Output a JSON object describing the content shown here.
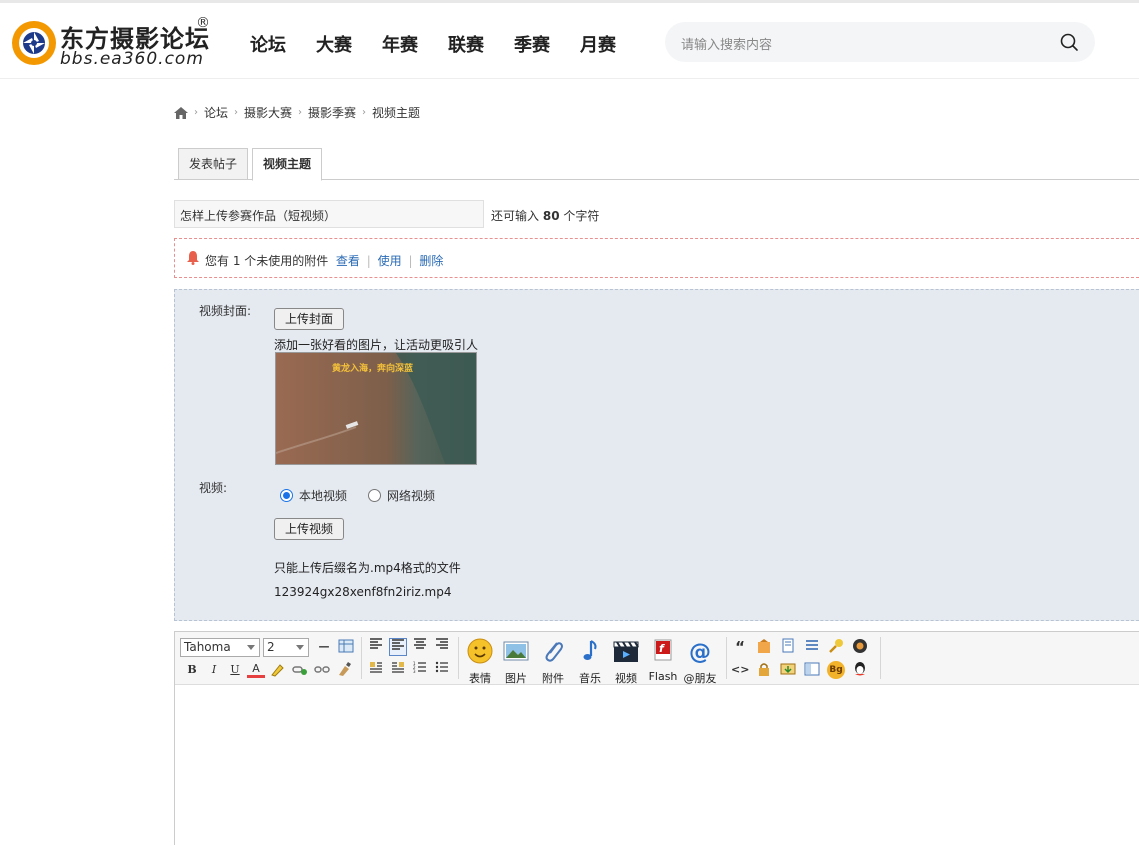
{
  "header": {
    "logo_title": "东方摄影论坛",
    "logo_reg": "®",
    "logo_url": "bbs.ea360.com",
    "nav": [
      "论坛",
      "大赛",
      "年赛",
      "联赛",
      "季赛",
      "月赛"
    ],
    "search_placeholder": "请输入搜索内容"
  },
  "breadcrumb": [
    "论坛",
    "摄影大赛",
    "摄影季赛",
    "视频主题"
  ],
  "tabs": [
    "发表帖子",
    "视频主题"
  ],
  "subject": {
    "value": "怎样上传参赛作品（短视频）",
    "remain_prefix": "还可输入",
    "remain_count": "80",
    "remain_suffix": "个字符"
  },
  "notice": {
    "text": "您有 1 个未使用的附件",
    "links": [
      "查看",
      "使用",
      "删除"
    ]
  },
  "cover": {
    "label": "视频封面:",
    "button": "上传封面",
    "hint": "添加一张好看的图片，让活动更吸引人",
    "image_caption": "黄龙入海，奔向深蓝"
  },
  "video": {
    "label": "视频:",
    "options": [
      "本地视频",
      "网络视频"
    ],
    "selected": "本地视频",
    "button": "上传视频",
    "hint": "只能上传后缀名为.mp4格式的文件",
    "filename": "123924gx28xenf8fn2iriz.mp4"
  },
  "editor": {
    "font": "Tahoma",
    "size": "2",
    "fmt": {
      "bold": "B",
      "italic": "I",
      "underline": "U",
      "color": "A"
    },
    "media": [
      "表情",
      "图片",
      "附件",
      "音乐",
      "视频",
      "Flash",
      "@朋友"
    ],
    "quote": "“",
    "code": "<>",
    "bg": "Bg"
  },
  "colors": {
    "accent": "#1a73e8",
    "link": "#2a6ab5",
    "logo_orange": "#f39800"
  }
}
